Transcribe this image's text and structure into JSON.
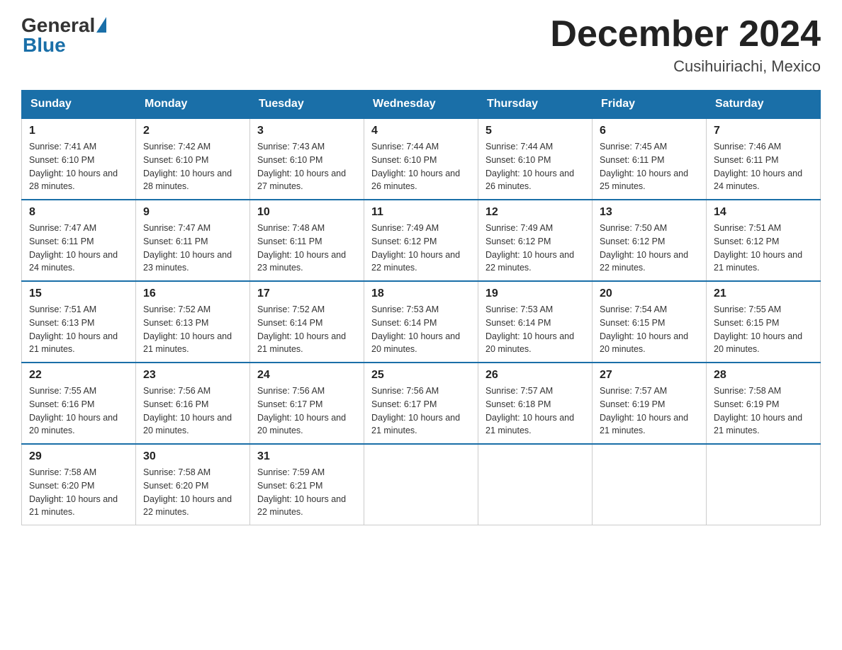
{
  "header": {
    "logo_general": "General",
    "logo_blue": "Blue",
    "month_title": "December 2024",
    "location": "Cusihuiriachi, Mexico"
  },
  "weekdays": [
    "Sunday",
    "Monday",
    "Tuesday",
    "Wednesday",
    "Thursday",
    "Friday",
    "Saturday"
  ],
  "weeks": [
    [
      {
        "num": "1",
        "sunrise": "7:41 AM",
        "sunset": "6:10 PM",
        "daylight": "10 hours and 28 minutes."
      },
      {
        "num": "2",
        "sunrise": "7:42 AM",
        "sunset": "6:10 PM",
        "daylight": "10 hours and 28 minutes."
      },
      {
        "num": "3",
        "sunrise": "7:43 AM",
        "sunset": "6:10 PM",
        "daylight": "10 hours and 27 minutes."
      },
      {
        "num": "4",
        "sunrise": "7:44 AM",
        "sunset": "6:10 PM",
        "daylight": "10 hours and 26 minutes."
      },
      {
        "num": "5",
        "sunrise": "7:44 AM",
        "sunset": "6:10 PM",
        "daylight": "10 hours and 26 minutes."
      },
      {
        "num": "6",
        "sunrise": "7:45 AM",
        "sunset": "6:11 PM",
        "daylight": "10 hours and 25 minutes."
      },
      {
        "num": "7",
        "sunrise": "7:46 AM",
        "sunset": "6:11 PM",
        "daylight": "10 hours and 24 minutes."
      }
    ],
    [
      {
        "num": "8",
        "sunrise": "7:47 AM",
        "sunset": "6:11 PM",
        "daylight": "10 hours and 24 minutes."
      },
      {
        "num": "9",
        "sunrise": "7:47 AM",
        "sunset": "6:11 PM",
        "daylight": "10 hours and 23 minutes."
      },
      {
        "num": "10",
        "sunrise": "7:48 AM",
        "sunset": "6:11 PM",
        "daylight": "10 hours and 23 minutes."
      },
      {
        "num": "11",
        "sunrise": "7:49 AM",
        "sunset": "6:12 PM",
        "daylight": "10 hours and 22 minutes."
      },
      {
        "num": "12",
        "sunrise": "7:49 AM",
        "sunset": "6:12 PM",
        "daylight": "10 hours and 22 minutes."
      },
      {
        "num": "13",
        "sunrise": "7:50 AM",
        "sunset": "6:12 PM",
        "daylight": "10 hours and 22 minutes."
      },
      {
        "num": "14",
        "sunrise": "7:51 AM",
        "sunset": "6:12 PM",
        "daylight": "10 hours and 21 minutes."
      }
    ],
    [
      {
        "num": "15",
        "sunrise": "7:51 AM",
        "sunset": "6:13 PM",
        "daylight": "10 hours and 21 minutes."
      },
      {
        "num": "16",
        "sunrise": "7:52 AM",
        "sunset": "6:13 PM",
        "daylight": "10 hours and 21 minutes."
      },
      {
        "num": "17",
        "sunrise": "7:52 AM",
        "sunset": "6:14 PM",
        "daylight": "10 hours and 21 minutes."
      },
      {
        "num": "18",
        "sunrise": "7:53 AM",
        "sunset": "6:14 PM",
        "daylight": "10 hours and 20 minutes."
      },
      {
        "num": "19",
        "sunrise": "7:53 AM",
        "sunset": "6:14 PM",
        "daylight": "10 hours and 20 minutes."
      },
      {
        "num": "20",
        "sunrise": "7:54 AM",
        "sunset": "6:15 PM",
        "daylight": "10 hours and 20 minutes."
      },
      {
        "num": "21",
        "sunrise": "7:55 AM",
        "sunset": "6:15 PM",
        "daylight": "10 hours and 20 minutes."
      }
    ],
    [
      {
        "num": "22",
        "sunrise": "7:55 AM",
        "sunset": "6:16 PM",
        "daylight": "10 hours and 20 minutes."
      },
      {
        "num": "23",
        "sunrise": "7:56 AM",
        "sunset": "6:16 PM",
        "daylight": "10 hours and 20 minutes."
      },
      {
        "num": "24",
        "sunrise": "7:56 AM",
        "sunset": "6:17 PM",
        "daylight": "10 hours and 20 minutes."
      },
      {
        "num": "25",
        "sunrise": "7:56 AM",
        "sunset": "6:17 PM",
        "daylight": "10 hours and 21 minutes."
      },
      {
        "num": "26",
        "sunrise": "7:57 AM",
        "sunset": "6:18 PM",
        "daylight": "10 hours and 21 minutes."
      },
      {
        "num": "27",
        "sunrise": "7:57 AM",
        "sunset": "6:19 PM",
        "daylight": "10 hours and 21 minutes."
      },
      {
        "num": "28",
        "sunrise": "7:58 AM",
        "sunset": "6:19 PM",
        "daylight": "10 hours and 21 minutes."
      }
    ],
    [
      {
        "num": "29",
        "sunrise": "7:58 AM",
        "sunset": "6:20 PM",
        "daylight": "10 hours and 21 minutes."
      },
      {
        "num": "30",
        "sunrise": "7:58 AM",
        "sunset": "6:20 PM",
        "daylight": "10 hours and 22 minutes."
      },
      {
        "num": "31",
        "sunrise": "7:59 AM",
        "sunset": "6:21 PM",
        "daylight": "10 hours and 22 minutes."
      },
      null,
      null,
      null,
      null
    ]
  ]
}
